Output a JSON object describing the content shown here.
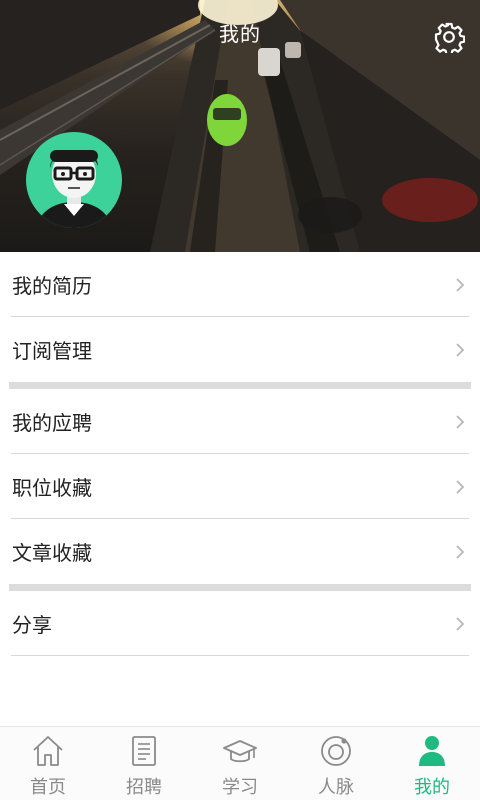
{
  "header": {
    "title": "我的",
    "settings_icon": "gear-icon",
    "avatar_icon": "user-avatar-glasses"
  },
  "menu": {
    "group1": [
      {
        "label": "我的简历"
      },
      {
        "label": "订阅管理"
      }
    ],
    "group2": [
      {
        "label": "我的应聘"
      },
      {
        "label": "职位收藏"
      },
      {
        "label": "文章收藏"
      }
    ],
    "group3": [
      {
        "label": "分享"
      }
    ]
  },
  "tabbar": {
    "tabs": [
      {
        "label": "首页",
        "icon": "home-icon",
        "active": false
      },
      {
        "label": "招聘",
        "icon": "document-icon",
        "active": false
      },
      {
        "label": "学习",
        "icon": "graduation-cap-icon",
        "active": false
      },
      {
        "label": "人脉",
        "icon": "orbit-icon",
        "active": false
      },
      {
        "label": "我的",
        "icon": "person-icon",
        "active": true
      }
    ]
  },
  "colors": {
    "accent": "#1fb981",
    "avatar_bg": "#3dd29a",
    "tab_inactive": "#8a8a8a"
  }
}
